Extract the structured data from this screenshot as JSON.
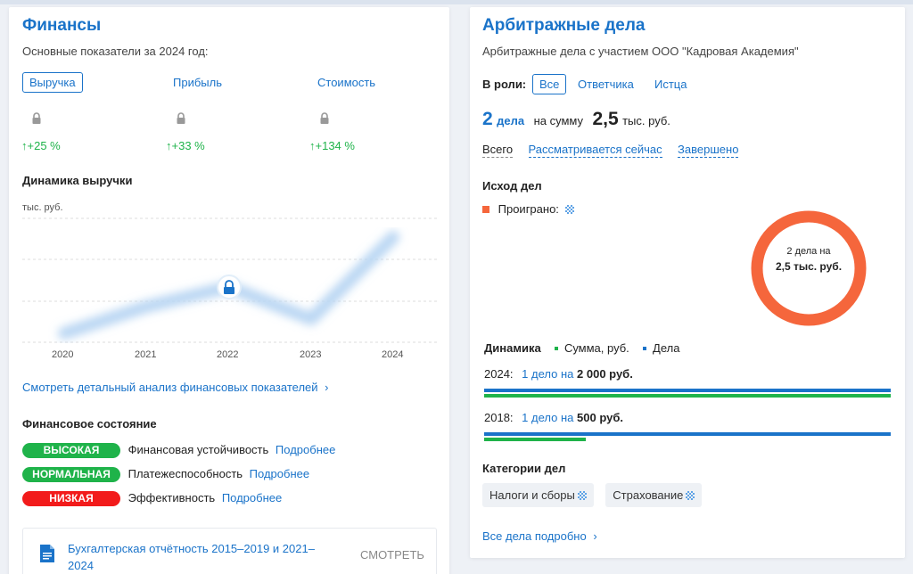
{
  "finances": {
    "title": "Финансы",
    "subtitle": "Основные показатели за 2024 год:",
    "metrics": [
      {
        "label": "Выручка",
        "change": "+25 %"
      },
      {
        "label": "Прибыль",
        "change": "+33 %"
      },
      {
        "label": "Стоимость",
        "change": "+134 %"
      }
    ],
    "dynamics_title": "Динамика выручки",
    "unit": "тыс. руб.",
    "years": [
      "2020",
      "2021",
      "2022",
      "2023",
      "2024"
    ],
    "detail_link": "Смотреть детальный анализ финансовых показателей",
    "state_title": "Финансовое состояние",
    "states": [
      {
        "badge": "ВЫСОКАЯ",
        "label": "Финансовая устойчивость",
        "link": "Подробнее",
        "color": "#1fb34a"
      },
      {
        "badge": "НОРМАЛЬНАЯ",
        "label": "Платежеспособность",
        "link": "Подробнее",
        "color": "#1fb34a"
      },
      {
        "badge": "НИЗКАЯ",
        "label": "Эффективность",
        "link": "Подробнее",
        "color": "#f21b1b"
      }
    ],
    "report_title": "Бухгалтерская отчётность 2015–2019 и 2021–2024",
    "report_action": "СМОТРЕТЬ"
  },
  "arbitration": {
    "title": "Арбитражные дела",
    "subtitle": "Арбитражные дела с участием ООО \"Кадровая Академия\"",
    "role_label": "В роли:",
    "roles": [
      "Все",
      "Ответчика",
      "Истца"
    ],
    "cases_count": "2",
    "cases_word": "дела",
    "sum_prefix": "на сумму",
    "sum_value": "2,5",
    "sum_unit": "тыс. руб.",
    "filters": [
      "Всего",
      "Рассматривается сейчас",
      "Завершено"
    ],
    "outcome_title": "Исход дел",
    "outcome_legend": "Проиграно:",
    "donut_line1": "2 дела на",
    "donut_line2": "2,5 тыс. руб.",
    "donut_color": "#f5663c",
    "dynamics_title": "Динамика",
    "legend_sum": "Сумма, руб.",
    "legend_cases": "Дела",
    "rows": [
      {
        "year": "2024:",
        "cases": "1 дело",
        "na": "на",
        "amount": "2 000 руб."
      },
      {
        "year": "2018:",
        "cases": "1 дело",
        "na": "на",
        "amount": "500 руб."
      }
    ],
    "categories_title": "Категории дел",
    "categories": [
      "Налоги и сборы",
      "Страхование"
    ],
    "all_link": "Все дела подробно"
  },
  "colors": {
    "accent": "#1a73c9",
    "green": "#1fb34a",
    "red": "#f21b1b"
  }
}
